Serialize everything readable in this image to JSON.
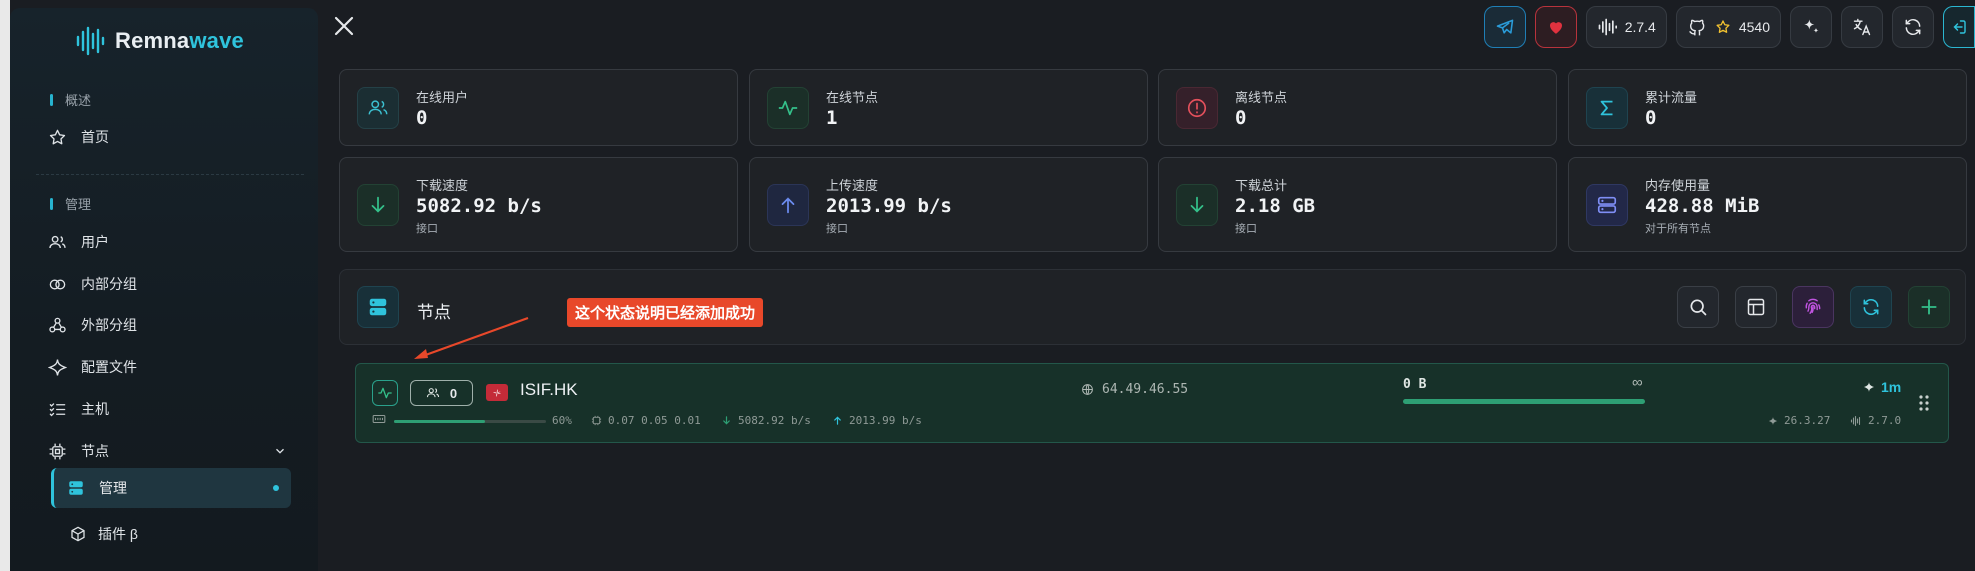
{
  "sidebar": {
    "logo": {
      "part1": "Remna",
      "part2": "wave"
    },
    "sections": [
      {
        "label": "概述"
      },
      {
        "label": "管理"
      }
    ],
    "items": {
      "home": "首页",
      "users": "用户",
      "internal_groups": "内部分组",
      "external_groups": "外部分组",
      "config": "配置文件",
      "hosts": "主机",
      "nodes": "节点",
      "nodes_manage": "管理",
      "plugins": "插件 β"
    }
  },
  "topbar": {
    "version": "2.7.4",
    "github_stars": "4540"
  },
  "stats": [
    {
      "label": "在线用户",
      "value": "0",
      "sub": "",
      "icon": "users-icon"
    },
    {
      "label": "在线节点",
      "value": "1",
      "sub": "",
      "icon": "activity-icon"
    },
    {
      "label": "离线节点",
      "value": "0",
      "sub": "",
      "icon": "alert-circle-icon"
    },
    {
      "label": "累计流量",
      "value": "0",
      "sub": "",
      "icon": "sigma-icon"
    },
    {
      "label": "下载速度",
      "value": "5082.92 b/s",
      "sub": "接口",
      "icon": "arrow-down-icon"
    },
    {
      "label": "上传速度",
      "value": "2013.99 b/s",
      "sub": "接口",
      "icon": "arrow-up-icon"
    },
    {
      "label": "下载总计",
      "value": "2.18 GB",
      "sub": "接口",
      "icon": "arrow-down-icon"
    },
    {
      "label": "内存使用量",
      "value": "428.88 MiB",
      "sub": "对于所有节点",
      "icon": "server-icon"
    }
  ],
  "nodes_panel": {
    "title": "节点",
    "annotation": "这个状态说明已经添加成功"
  },
  "node": {
    "users_online": "0",
    "name": "ISIF.HK",
    "ip": "64.49.46.55",
    "traffic_used": "0 B",
    "traffic_limit": "∞",
    "uptime": "1m",
    "mem_percent": "60%",
    "mem_fraction": 0.6,
    "load": "0.07 0.05 0.01",
    "download": "5082.92 b/s",
    "upload": "2013.99 b/s",
    "xray_version": "26.3.27",
    "node_version": "2.7.0"
  },
  "colors": {
    "accent": "#2fc3dc",
    "green": "#2e9f74",
    "annotation": "#e8482a"
  }
}
